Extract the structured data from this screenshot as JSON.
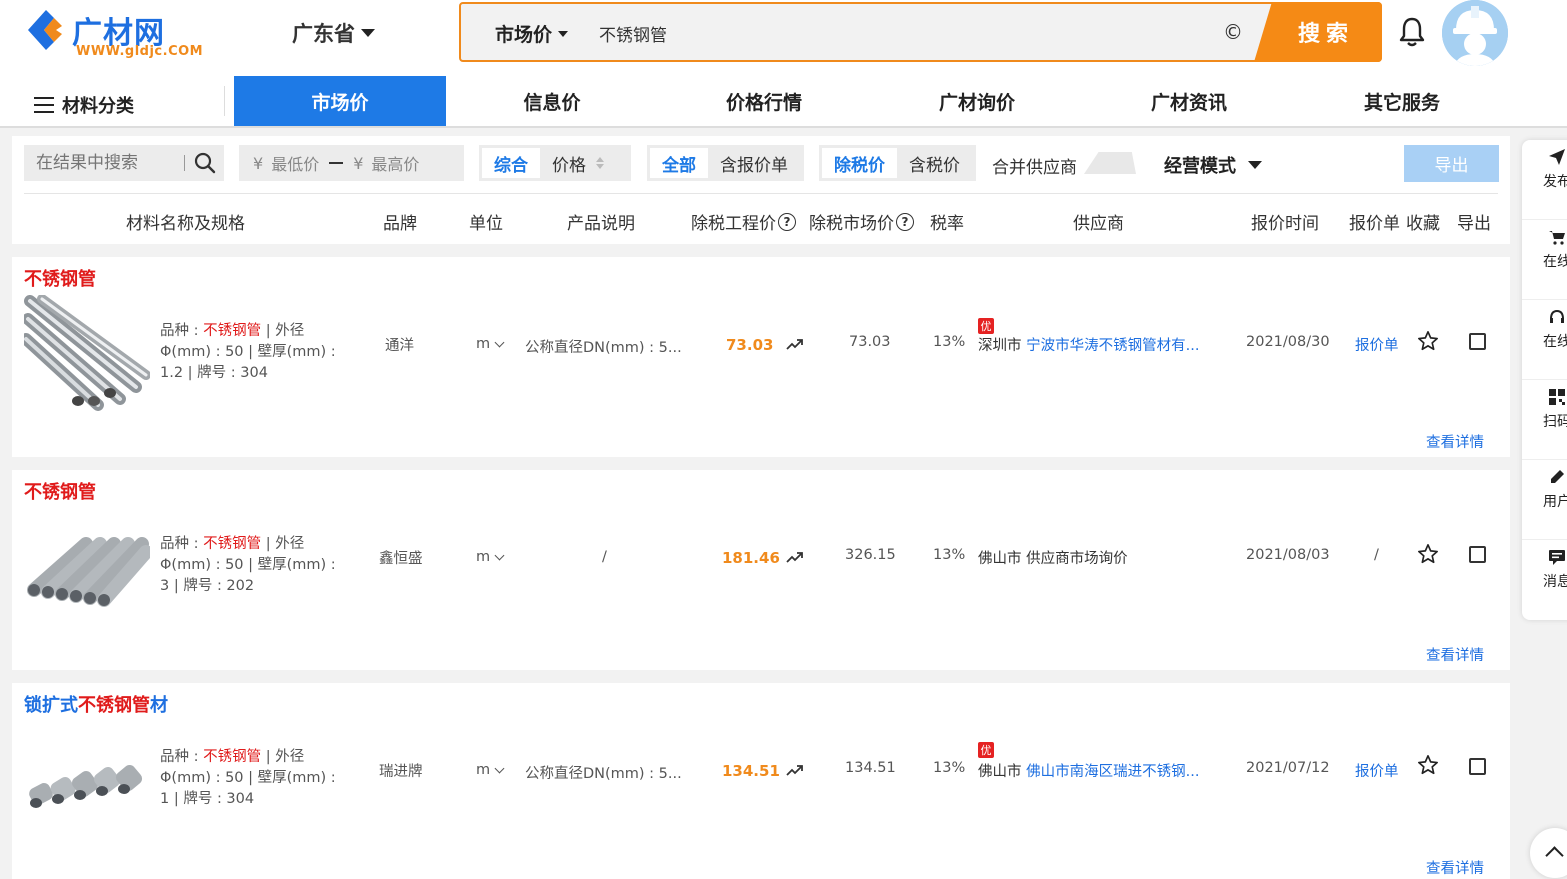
{
  "header": {
    "logo_text": "广材网",
    "logo_url": "WWW.gldjc.COM",
    "province": "广东省",
    "search": {
      "type": "市场价",
      "value": "不锈钢管",
      "clear_glyph": "©",
      "button": "搜索"
    }
  },
  "nav": {
    "category": "材料分类",
    "tabs": [
      "市场价",
      "信息价",
      "价格行情",
      "广材询价",
      "广材资讯",
      "其它服务"
    ],
    "active": "市场价"
  },
  "filters": {
    "result_search_placeholder": "在结果中搜索",
    "min_price": "最低价",
    "max_price": "最高价",
    "currency": "¥",
    "sort": [
      "综合",
      "价格"
    ],
    "quote_filter": [
      "全部",
      "含报价单"
    ],
    "tax_filter": [
      "除税价",
      "含税价"
    ],
    "merge_supplier": "合并供应商",
    "mode": "经营模式",
    "export": "导出"
  },
  "columns": {
    "name": "材料名称及规格",
    "brand": "品牌",
    "unit": "单位",
    "desc": "产品说明",
    "eng_price": "除税工程价",
    "market_price": "除税市场价",
    "tax": "税率",
    "supplier": "供应商",
    "time": "报价时间",
    "quote": "报价单",
    "fav": "收藏",
    "export": "导出"
  },
  "rows": [
    {
      "title_parts": [
        {
          "text": "不锈钢管",
          "color": "red"
        }
      ],
      "spec_label1": "品种 : ",
      "spec_kw": "不锈钢管",
      "spec_rest": " | 外径Φ(mm) : 50 | 壁厚(mm) : 1.2 | 牌号 : 304",
      "brand": "通洋",
      "unit": "m",
      "desc": "公称直径DN(mm) : 5...",
      "eng_price": "73.03",
      "market_price": "73.03",
      "tax": "13%",
      "badge": "优",
      "city": "深圳市",
      "supplier": "宁波市华涛不锈钢管材有...",
      "time": "2021/08/30",
      "quote": "报价单",
      "detail": "查看详情"
    },
    {
      "title_parts": [
        {
          "text": "不锈钢管",
          "color": "red"
        }
      ],
      "spec_label1": "品种 : ",
      "spec_kw": "不锈钢管",
      "spec_rest": " | 外径Φ(mm) : 50 | 壁厚(mm) : 3 | 牌号 : 202",
      "brand": "鑫恒盛",
      "unit": "m",
      "desc": "/",
      "eng_price": "181.46",
      "market_price": "326.15",
      "tax": "13%",
      "badge": "",
      "city": "佛山市",
      "supplier": "供应商市场询价",
      "time": "2021/08/03",
      "quote": "/",
      "detail": "查看详情"
    },
    {
      "title_parts": [
        {
          "text": "锁扩式",
          "color": "blue"
        },
        {
          "text": "不锈钢管",
          "color": "red"
        },
        {
          "text": "材",
          "color": "blue"
        }
      ],
      "spec_label1": "品种 : ",
      "spec_kw": "不锈钢管",
      "spec_rest": " | 外径Φ(mm) : 50 | 壁厚(mm) : 1 | 牌号 : 304",
      "brand": "瑞进牌",
      "unit": "m",
      "desc": "公称直径DN(mm) : 5...",
      "eng_price": "134.51",
      "market_price": "134.51",
      "tax": "13%",
      "badge": "优",
      "city": "佛山市",
      "supplier": "佛山市南海区瑞进不锈钢...",
      "time": "2021/07/12",
      "quote": "报价单",
      "detail": "查看详情"
    }
  ],
  "side_tools": [
    {
      "icon": "send-icon",
      "label": "发布询价"
    },
    {
      "icon": "cart-icon",
      "label": "在线购买"
    },
    {
      "icon": "headset-icon",
      "label": "在线客服"
    },
    {
      "icon": "qrcode-icon",
      "label": "扫码关注"
    },
    {
      "icon": "pencil-icon",
      "label": "用户反馈"
    },
    {
      "icon": "message-icon",
      "label": "消息提醒"
    }
  ]
}
